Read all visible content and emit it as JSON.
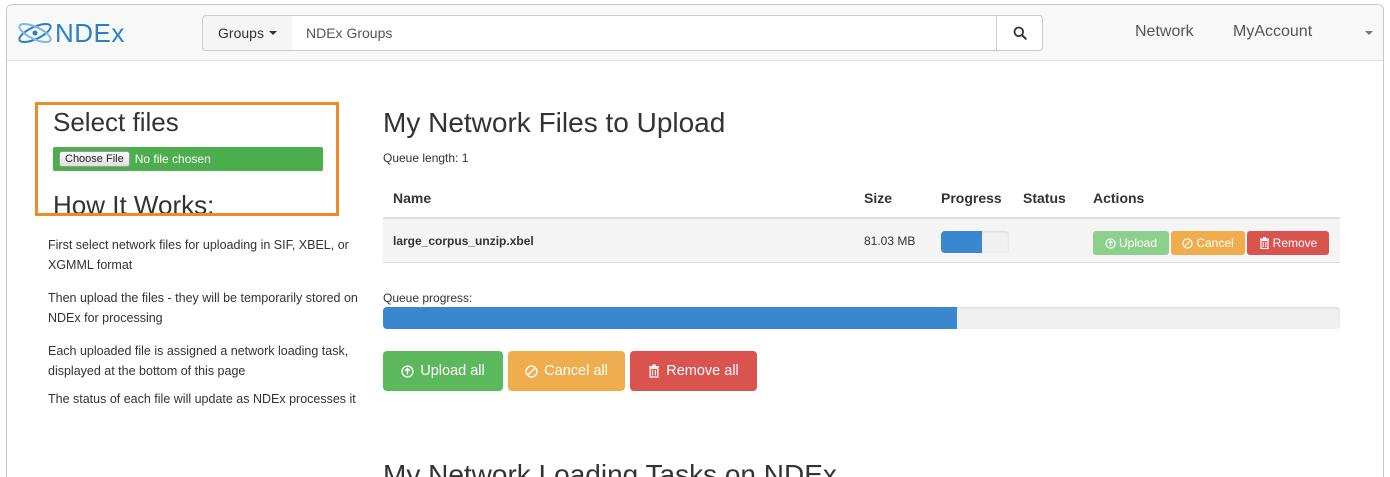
{
  "colors": {
    "brand": "#2a7fc9",
    "success": "#5cb85c",
    "warning": "#f0ad4e",
    "danger": "#d9534f",
    "progress": "#3a87d0",
    "highlight": "#f08a24"
  },
  "navbar": {
    "logo_text": "NDEx",
    "groups_label": "Groups",
    "search_placeholder": "NDEx Groups",
    "links": [
      "Network",
      "MyAccount"
    ]
  },
  "sidebar": {
    "select_title": "Select files",
    "choose_file_label": "Choose File",
    "no_file_text": "No file chosen",
    "how_title": "How It Works:",
    "help": [
      "First select network files for uploading in SIF, XBEL, or XGMML format",
      "Then upload the files - they will be temporarily stored on NDEx for processing",
      "Each uploaded file is assigned a network loading task, displayed at the bottom of this page",
      "The status of each file will update as NDEx processes it"
    ]
  },
  "main": {
    "title": "My Network Files to Upload",
    "queue_length": "Queue length: 1",
    "columns": [
      "Name",
      "Size",
      "Progress",
      "Status",
      "Actions"
    ],
    "rows": [
      {
        "name": "large_corpus_unzip.xbel",
        "size": "81.03 MB",
        "progress": 0.6,
        "status": "",
        "actions": [
          "Upload",
          "Cancel",
          "Remove"
        ]
      }
    ],
    "queue_progress_label": "Queue progress:",
    "queue_progress": 0.6,
    "bulk_actions": [
      "Upload all",
      "Cancel all",
      "Remove all"
    ],
    "tasks_title": "My Network Loading Tasks on NDEx"
  }
}
